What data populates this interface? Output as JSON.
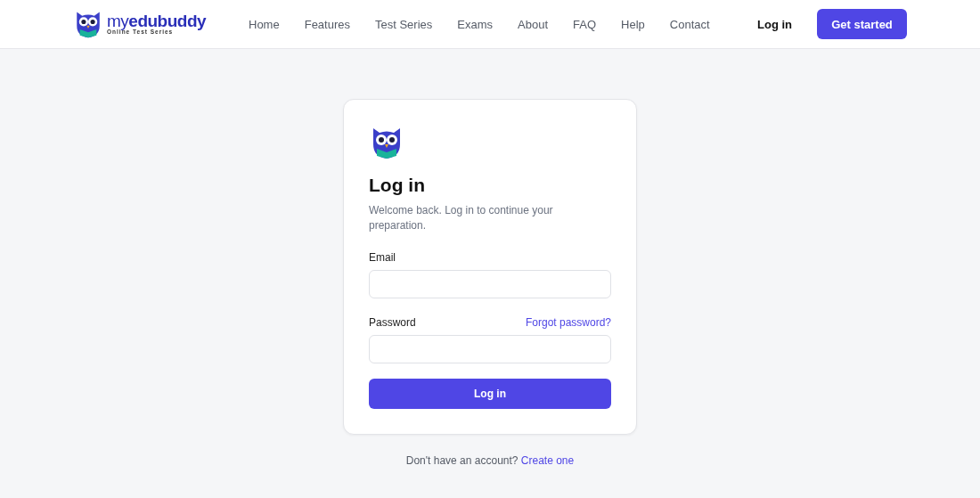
{
  "header": {
    "brand": "my**edubuddy**",
    "tagline": "Online Test Series",
    "nav": [
      {
        "label": "Home"
      },
      {
        "label": "Features"
      },
      {
        "label": "Test Series"
      },
      {
        "label": "Exams"
      },
      {
        "label": "About"
      },
      {
        "label": "FAQ"
      },
      {
        "label": "Help"
      },
      {
        "label": "Contact"
      }
    ],
    "login": "Log in",
    "cta": "Get started"
  },
  "card": {
    "title": "Log in",
    "subtitle": "Welcome back. Log in to continue your preparation.",
    "email": {
      "label": "Email"
    },
    "password": {
      "label": "Password",
      "forgot": "Forgot password?"
    },
    "submit": "Log in"
  },
  "footer": {
    "prompt": "Don't have an account?",
    "link": "Create one"
  }
}
